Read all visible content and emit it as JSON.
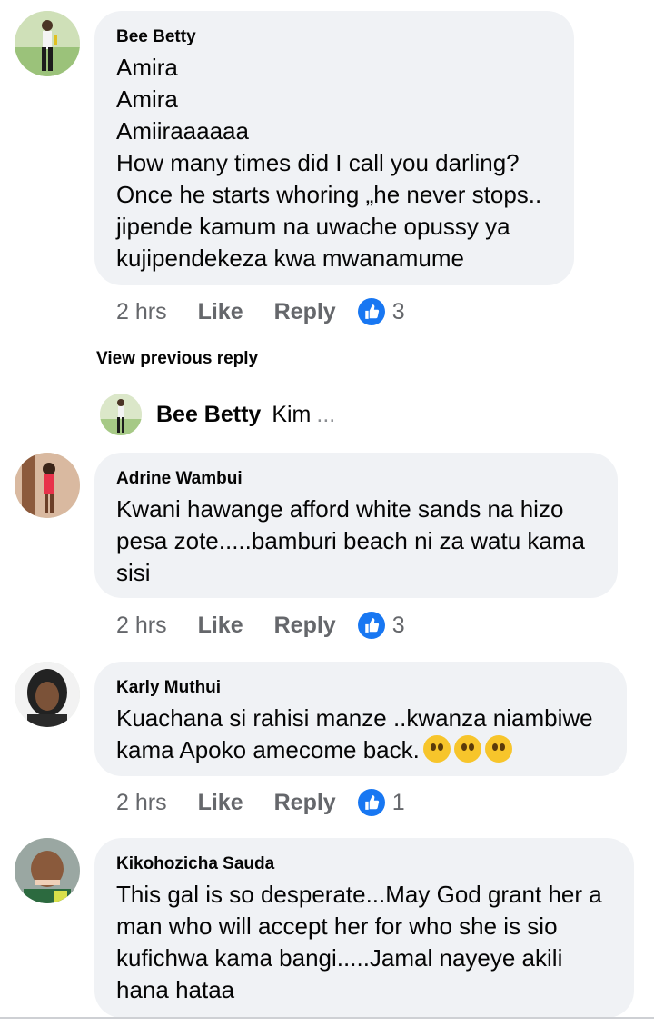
{
  "comments": [
    {
      "author": "Bee Betty",
      "lines": [
        "Amira",
        "Amira",
        "Amiiraaaaaa",
        "How many times did I call you darling?",
        "Once he starts whoring „he never stops..",
        "jipende kamum na uwache opussy ya",
        "kujipendekeza kwa mwanamume"
      ],
      "time": "2 hrs",
      "like_label": "Like",
      "reply_label": "Reply",
      "likes": "3",
      "avatar_icon": "user-avatar-photo"
    },
    {
      "author": "Adrine Wambui",
      "lines": [
        "Kwani hawange afford white sands na hizo",
        "pesa zote.....bamburi beach ni za watu kama",
        "sisi"
      ],
      "time": "2 hrs",
      "like_label": "Like",
      "reply_label": "Reply",
      "likes": "3",
      "avatar_icon": "user-avatar-photo"
    },
    {
      "author": "Karly Muthui",
      "lines": [
        "Kuachana si rahisi manze ..kwanza niambiwe",
        "kama Apoko amecome back."
      ],
      "time": "2 hrs",
      "like_label": "Like",
      "reply_label": "Reply",
      "likes": "1",
      "avatar_icon": "user-avatar-photo",
      "emojis": [
        "thinking-face-emoji",
        "rolling-eyes-emoji",
        "hand-over-mouth-emoji"
      ]
    },
    {
      "author": "Kikohozicha Sauda",
      "lines": [
        "This gal is so desperate...May God grant her a",
        "man who will accept her for who she is sio",
        "kufichwa kama bangi.....Jamal nayeye akili",
        "hana hataa"
      ],
      "avatar_icon": "user-avatar-photo"
    }
  ],
  "view_previous": "View previous reply",
  "reply_preview": {
    "author": "Bee Betty",
    "snippet": "Kim",
    "ellipsis": "..."
  },
  "colors": {
    "bubble": "#f0f2f5",
    "like_blue": "#1877f2",
    "meta_gray": "#65676b"
  }
}
